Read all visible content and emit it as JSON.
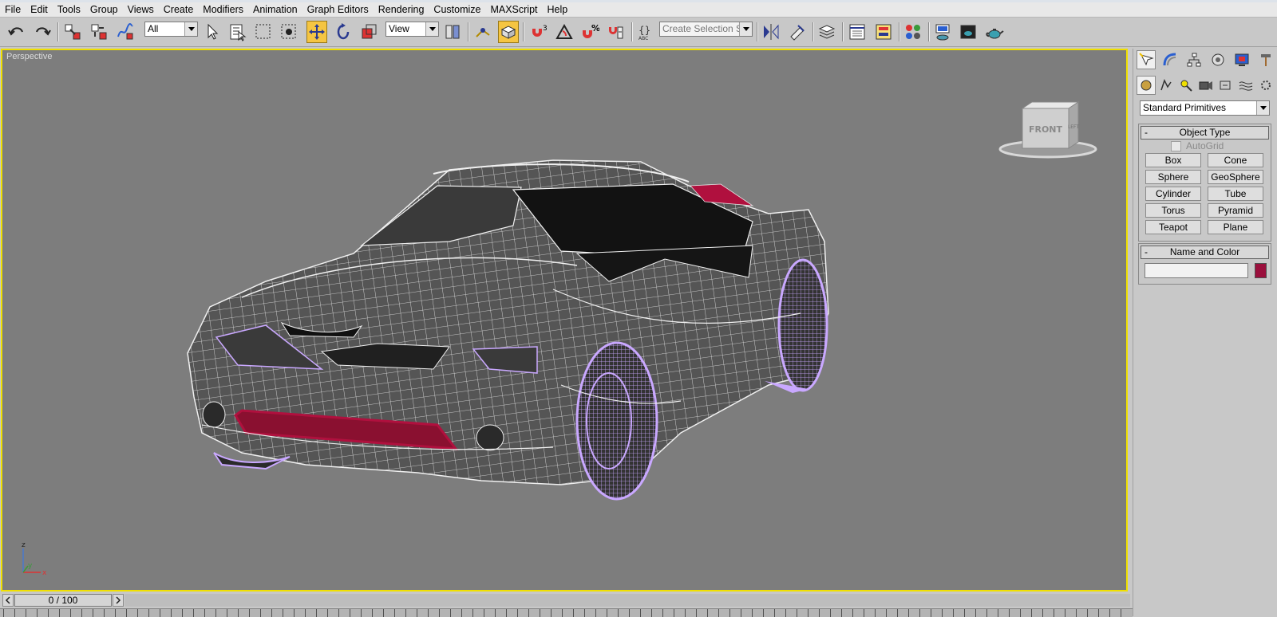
{
  "menu": [
    "File",
    "Edit",
    "Tools",
    "Group",
    "Views",
    "Create",
    "Modifiers",
    "Animation",
    "Graph Editors",
    "Rendering",
    "Customize",
    "MAXScript",
    "Help"
  ],
  "toolbar": {
    "selection_filter": "All",
    "reference_coord": "View",
    "snap_label": "3",
    "percent_label": "%",
    "named_selection_placeholder": "Create Selection Set"
  },
  "viewport": {
    "label": "Perspective",
    "viewcube_face": "FRONT",
    "viewcube_side": "LEFT",
    "axis_z": "z",
    "axis_y": "y",
    "axis_x": "x"
  },
  "command_panel": {
    "category": "Standard Primitives",
    "object_type_title": "Object Type",
    "autogrid_label": "AutoGrid",
    "primitives": [
      "Box",
      "Cone",
      "Sphere",
      "GeoSphere",
      "Cylinder",
      "Tube",
      "Torus",
      "Pyramid",
      "Teapot",
      "Plane"
    ],
    "name_color_title": "Name and Color",
    "name_value": "",
    "object_color": "#9a0f3c"
  },
  "timeline": {
    "frame_label": "0 / 100"
  },
  "colors": {
    "viewport_bg": "#7d7d7d",
    "active_border": "#f0e000",
    "wire_body": "#e6e6e6",
    "wire_wheel": "#c9a8ff",
    "wire_grille": "#b0103e"
  }
}
